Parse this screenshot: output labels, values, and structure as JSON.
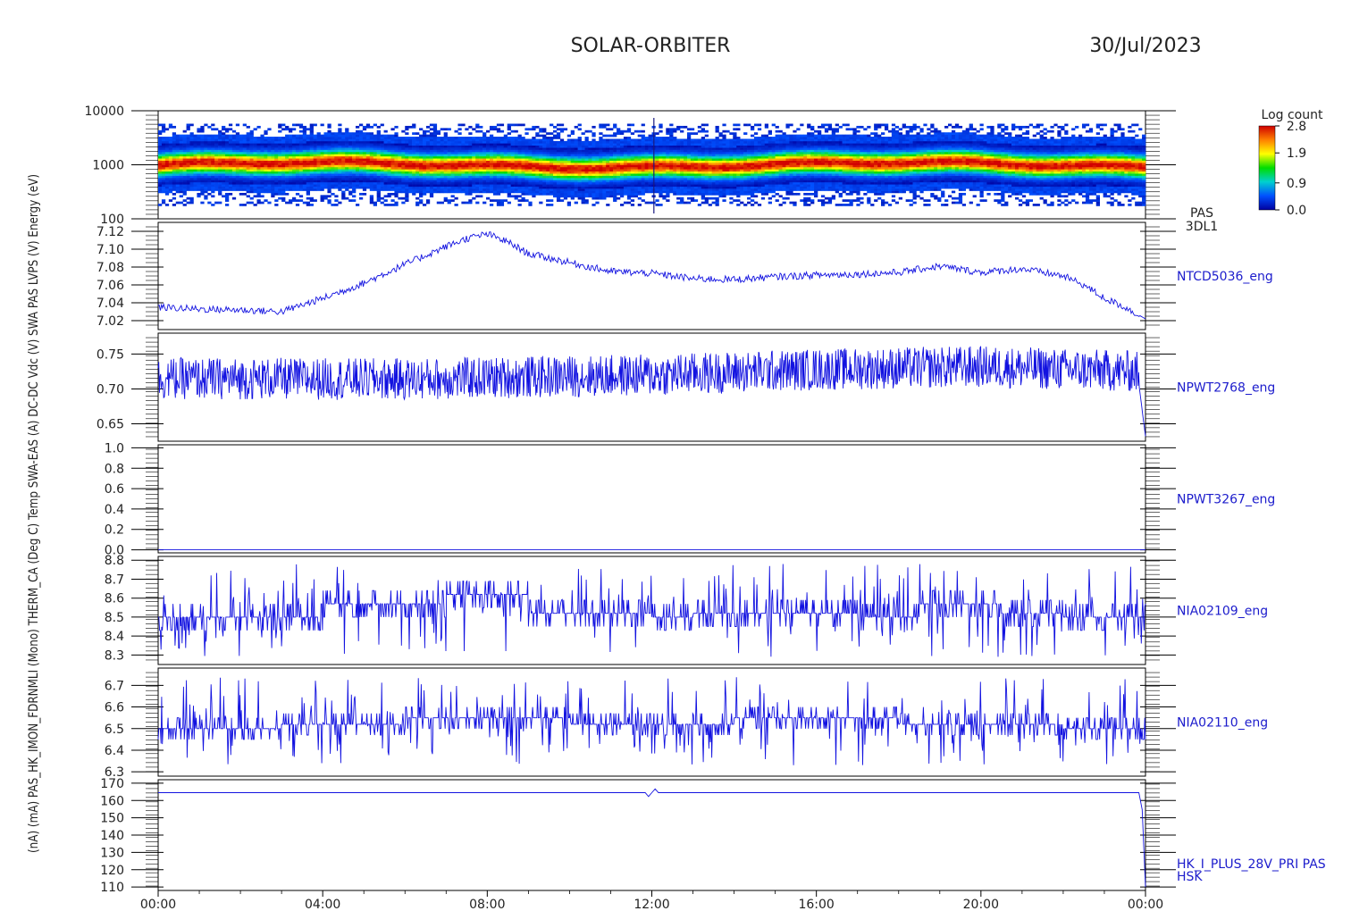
{
  "header": {
    "mission": "SOLAR-ORBITER",
    "date": "30/Jul/2023"
  },
  "colorbar": {
    "title": "Log count",
    "ticks": [
      "2.8",
      "1.9",
      "0.9",
      "0.0"
    ],
    "values": [
      2.8,
      1.9,
      0.9,
      0.0
    ],
    "colors": [
      "#d00000",
      "#ff8000",
      "#ffff00",
      "#00dd00",
      "#00d0d0",
      "#0050ff",
      "#0000a0"
    ]
  },
  "y_axis_label_overlap": "(nA) (mA) PAS_HK_IMON_FDRNMLI (Mono) THERM_CA (Deg C) Temp SWA-EAS (A) DC-DC Vdc (V) SWA PAS LVPS (V) Energy (eV)",
  "x_ticks": [
    "00:00",
    "04:00",
    "08:00",
    "12:00",
    "16:00",
    "20:00",
    "00:00"
  ],
  "chart_data": [
    {
      "type": "heatmap",
      "label": "PAS\n3DL1",
      "label_lines": [
        "PAS",
        "3DL1"
      ],
      "y_scale": "log",
      "ylim": [
        100,
        10000
      ],
      "yticks": [
        "10000",
        "1000",
        "100"
      ],
      "ytick_values": [
        10000,
        1000,
        100
      ],
      "x_range_hours": [
        0,
        24
      ],
      "peak_energy_ev": 950,
      "peak_log_count": 2.8,
      "spike_time_h": 12.05,
      "ylabel": "Energy (eV)"
    },
    {
      "type": "line",
      "label": "NTCD5036_eng",
      "ylim": [
        7.01,
        7.13
      ],
      "yticks": [
        "7.12",
        "7.10",
        "7.08",
        "7.06",
        "7.04",
        "7.02"
      ],
      "ytick_values": [
        7.12,
        7.1,
        7.08,
        7.06,
        7.04,
        7.02
      ],
      "x": [
        0,
        1,
        2,
        3,
        4,
        5,
        6,
        7,
        7.5,
        8,
        8.5,
        9,
        10,
        11,
        12,
        13,
        14,
        15,
        16,
        17,
        18,
        19,
        20,
        21,
        22,
        22.5,
        23,
        23.5,
        24
      ],
      "y": [
        7.035,
        7.033,
        7.032,
        7.03,
        7.045,
        7.062,
        7.083,
        7.103,
        7.112,
        7.117,
        7.108,
        7.095,
        7.085,
        7.075,
        7.073,
        7.067,
        7.066,
        7.069,
        7.071,
        7.072,
        7.074,
        7.081,
        7.074,
        7.078,
        7.07,
        7.06,
        7.045,
        7.035,
        7.022
      ],
      "noise": 0.004
    },
    {
      "type": "line",
      "label": "NPWT2768_eng",
      "ylim": [
        0.625,
        0.78
      ],
      "yticks": [
        "0.75",
        "0.70",
        "0.65"
      ],
      "ytick_values": [
        0.75,
        0.7,
        0.65
      ],
      "x": [
        0,
        6,
        12,
        16,
        20,
        23.8,
        24
      ],
      "y": [
        0.715,
        0.714,
        0.72,
        0.728,
        0.732,
        0.725,
        0.632
      ],
      "noise": 0.03
    },
    {
      "type": "line",
      "label": "NPWT3267_eng",
      "ylim": [
        -0.03,
        1.03
      ],
      "yticks": [
        "1.0",
        "0.8",
        "0.6",
        "0.4",
        "0.2",
        "0.0"
      ],
      "ytick_values": [
        1.0,
        0.8,
        0.6,
        0.4,
        0.2,
        0.0
      ],
      "x": [
        0,
        24
      ],
      "y": [
        0.0,
        0.0
      ],
      "noise": 0
    },
    {
      "type": "line",
      "label": "NIA02109_eng",
      "ylim": [
        8.25,
        8.82
      ],
      "yticks": [
        "8.8",
        "8.7",
        "8.6",
        "8.5",
        "8.4",
        "8.3"
      ],
      "ytick_values": [
        8.8,
        8.7,
        8.6,
        8.5,
        8.4,
        8.3
      ],
      "levels": [
        8.5,
        8.57,
        8.62
      ],
      "level_schedule_h": [
        [
          0,
          4,
          8.5
        ],
        [
          4,
          5.5,
          8.57
        ],
        [
          5.5,
          7,
          8.57
        ],
        [
          7,
          9,
          8.62
        ],
        [
          9,
          12,
          8.52
        ],
        [
          12,
          13,
          8.5
        ],
        [
          13,
          17,
          8.52
        ],
        [
          17,
          18.5,
          8.5
        ],
        [
          18.5,
          20.5,
          8.57
        ],
        [
          20.5,
          22,
          8.52
        ],
        [
          22,
          24,
          8.5
        ]
      ],
      "spike_range": [
        8.29,
        8.78
      ]
    },
    {
      "type": "line",
      "label": "NIA02110_eng",
      "ylim": [
        6.28,
        6.78
      ],
      "yticks": [
        "6.7",
        "6.6",
        "6.5",
        "6.4",
        "6.3"
      ],
      "ytick_values": [
        6.7,
        6.6,
        6.5,
        6.4,
        6.3
      ],
      "levels": [
        6.5,
        6.55
      ],
      "level_schedule_h": [
        [
          0,
          3,
          6.5
        ],
        [
          3,
          6,
          6.52
        ],
        [
          6,
          10,
          6.55
        ],
        [
          10,
          14,
          6.52
        ],
        [
          14,
          18,
          6.55
        ],
        [
          18,
          22,
          6.52
        ],
        [
          22,
          24,
          6.5
        ]
      ],
      "spike_range": [
        6.33,
        6.74
      ]
    },
    {
      "type": "line",
      "label": "HK_I_PLUS_28V_PRI PAS\nHSK",
      "label_lines": [
        "HK_I_PLUS_28V_PRI PAS",
        "HSK"
      ],
      "ylim": [
        108,
        172
      ],
      "yticks": [
        "170",
        "160",
        "150",
        "140",
        "130",
        "120",
        "110"
      ],
      "ytick_values": [
        170,
        160,
        150,
        140,
        130,
        120,
        110
      ],
      "x": [
        0,
        11.9,
        11.95,
        12.05,
        12.1,
        12.15,
        23.9,
        23.95,
        24
      ],
      "y": [
        164.5,
        164.5,
        159,
        170,
        164.5,
        164.5,
        164.5,
        140,
        110
      ],
      "noise": 0
    }
  ]
}
